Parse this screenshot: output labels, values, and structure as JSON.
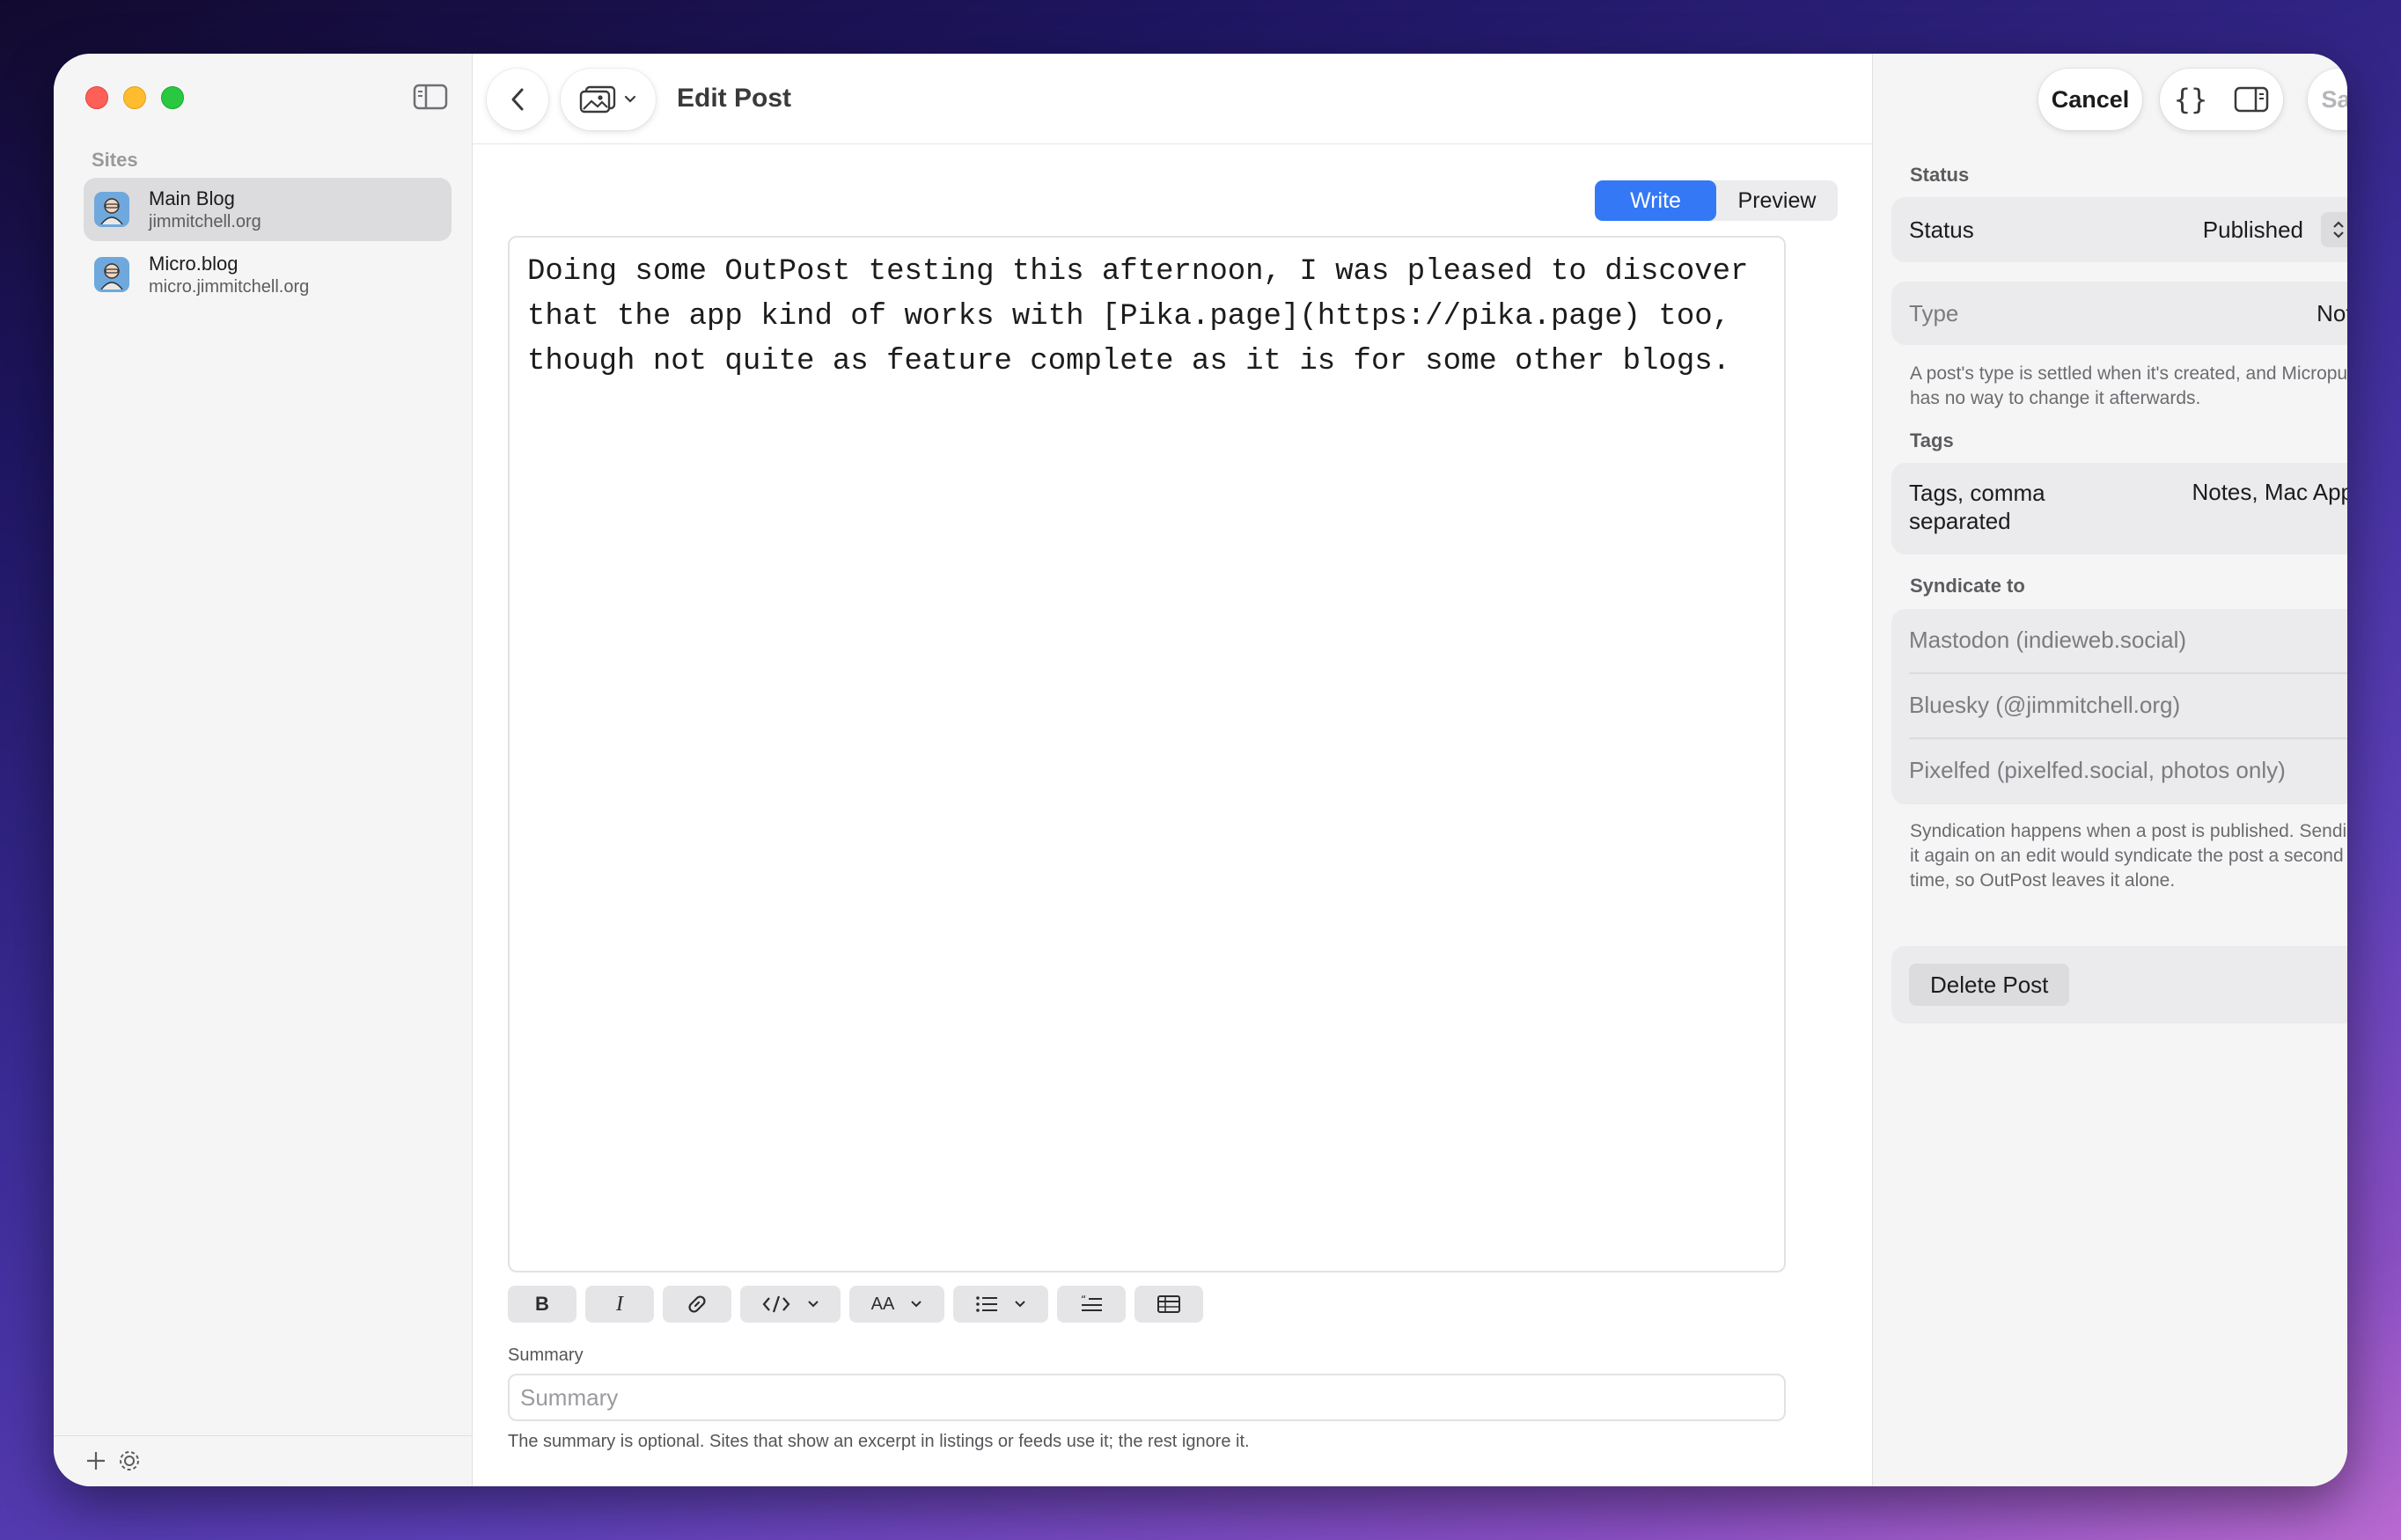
{
  "sidebar": {
    "section_title": "Sites",
    "sites": [
      {
        "name": "Main Blog",
        "url": "jimmitchell.org"
      },
      {
        "name": "Micro.blog",
        "url": "micro.jimmitchell.org"
      }
    ]
  },
  "main": {
    "title": "Edit Post",
    "tabs": {
      "write": "Write",
      "preview": "Preview"
    },
    "body_text": "Doing some OutPost testing this afternoon, I was pleased to discover\nthat the app kind of works with [Pika.page](https://pika.page) too,\nthough not quite as feature complete as it is for some other blogs.",
    "format_bar": {
      "bold": "B",
      "italic": "I",
      "text_size": "AA"
    },
    "summary": {
      "label": "Summary",
      "placeholder": "Summary",
      "help": "The summary is optional. Sites that show an excerpt in listings or feeds use it; the rest ignore it."
    }
  },
  "inspector": {
    "cancel_label": "Cancel",
    "save_label": "Save",
    "status_section": "Status",
    "status_label": "Status",
    "status_value": "Published",
    "type_label": "Type",
    "type_value": "Note",
    "type_help": "A post's type is settled when it's created, and Micropub has no way to change it afterwards.",
    "tags_section": "Tags",
    "tags_label_line1": "Tags, comma",
    "tags_label_line2": "separated",
    "tags_value": "Notes, Mac Apps",
    "syndicate_section": "Syndicate to",
    "syndicate_targets": [
      "Mastodon (indieweb.social)",
      "Bluesky (@jimmitchell.org)",
      "Pixelfed (pixelfed.social, photos only)"
    ],
    "syndicate_help": "Syndication happens when a post is published. Sending it again on an edit would syndicate the post a second time, so OutPost leaves it alone.",
    "delete_label": "Delete Post"
  },
  "colors": {
    "accent": "#3478f6",
    "traffic_red": "#fe5f57",
    "traffic_yellow": "#febc2e",
    "traffic_green": "#28c840"
  },
  "icons": [
    "sidebar-toggle-icon",
    "chevron-left-icon",
    "photo-library-icon",
    "add-icon",
    "gear-icon",
    "braces-icon",
    "inspector-toggle-icon",
    "link-icon",
    "code-icon",
    "list-icon",
    "blockquote-icon",
    "table-icon",
    "up-down-chevron-icon"
  ]
}
